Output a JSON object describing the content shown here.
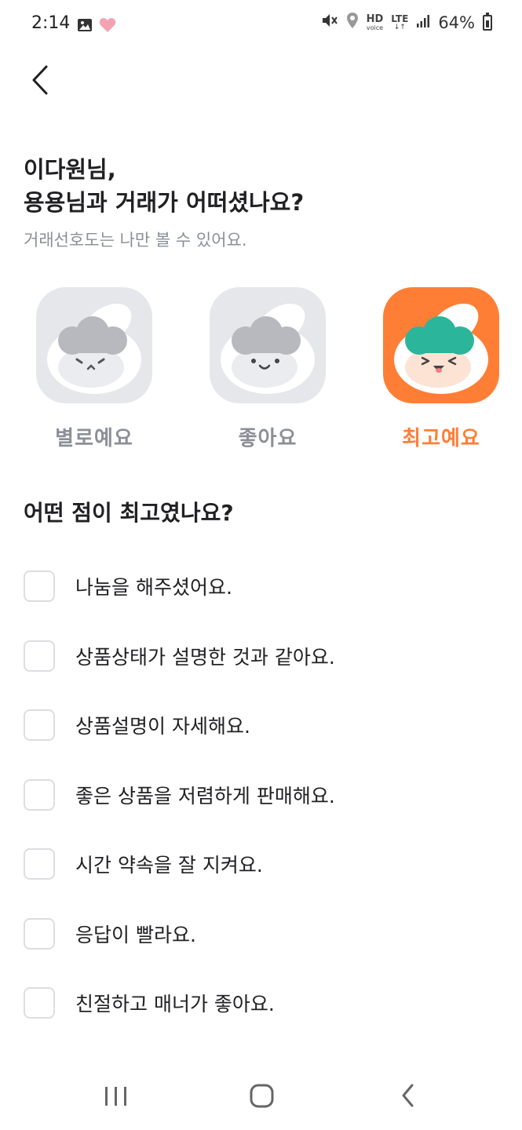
{
  "status_bar": {
    "time": "2:14",
    "hd_label": "HD",
    "voice_label": "voice",
    "lte_label": "LTE",
    "battery_text": "64%",
    "icons": [
      "image-icon",
      "heart-icon",
      "mute-icon",
      "location-icon",
      "signal-icon",
      "battery-icon"
    ]
  },
  "header": {
    "back_icon": "chevron-left-icon",
    "title_line1": "이다원님,",
    "title_line2": "용용님과 거래가 어떠셨나요?",
    "subtitle": "거래선호도는 나만 볼 수 있어요."
  },
  "ratings": [
    {
      "label": "별로예요",
      "selected": false
    },
    {
      "label": "좋아요",
      "selected": false
    },
    {
      "label": "최고예요",
      "selected": true
    }
  ],
  "colors": {
    "accent": "#ff7e36",
    "muted_text": "#8b8f97",
    "inactive_bg": "#e6e7eb",
    "checkbox_border": "#dcdee3",
    "mascot_hair_green": "#2bb59b"
  },
  "section": {
    "title": "어떤 점이 최고였나요?"
  },
  "options": [
    {
      "label": "나눔을 해주셨어요.",
      "checked": false
    },
    {
      "label": "상품상태가 설명한 것과 같아요.",
      "checked": false
    },
    {
      "label": "상품설명이 자세해요.",
      "checked": false
    },
    {
      "label": "좋은 상품을 저렴하게 판매해요.",
      "checked": false
    },
    {
      "label": "시간 약속을 잘 지켜요.",
      "checked": false
    },
    {
      "label": "응답이 빨라요.",
      "checked": false
    },
    {
      "label": "친절하고 매너가 좋아요.",
      "checked": false
    }
  ],
  "nav_bar": {
    "icons": [
      "recent-apps-icon",
      "home-icon",
      "back-icon"
    ]
  }
}
